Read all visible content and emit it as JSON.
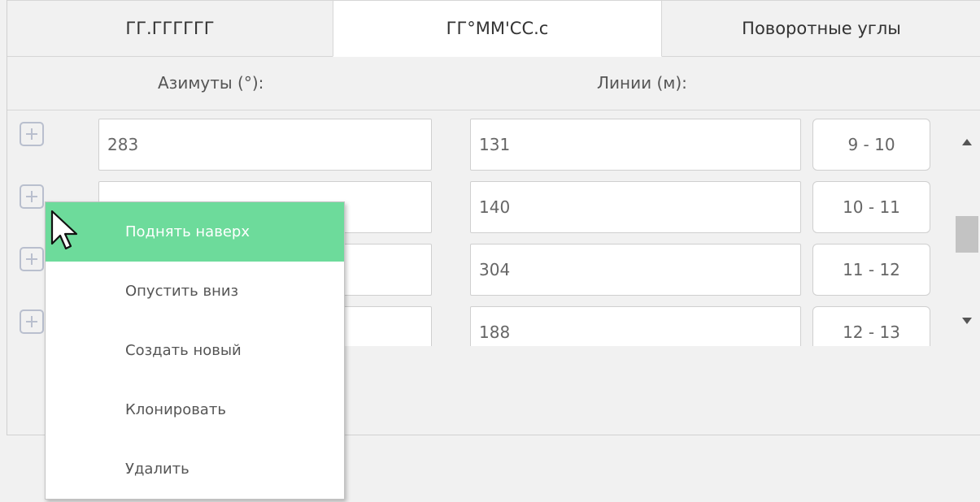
{
  "tabs": [
    {
      "label": "ГГ.ГГГГГГ",
      "active": false
    },
    {
      "label": "ГГ°ММ'СС.с",
      "active": true
    },
    {
      "label": "Поворотные углы",
      "active": false
    }
  ],
  "headers": {
    "azimuths": "Азимуты (°):",
    "lines": "Линии (м):"
  },
  "rows": [
    {
      "azimuth": "283",
      "line": "131",
      "segment": "9 - 10"
    },
    {
      "azimuth": "",
      "line": "140",
      "segment": "10 - 11"
    },
    {
      "azimuth": "",
      "line": "304",
      "segment": "11 - 12"
    },
    {
      "azimuth": "",
      "line": "188",
      "segment": "12 - 13"
    }
  ],
  "context_menu": {
    "items": [
      {
        "label": "Поднять наверх",
        "highlighted": true
      },
      {
        "label": "Опустить вниз",
        "highlighted": false
      },
      {
        "label": "Создать новый",
        "highlighted": false
      },
      {
        "label": "Клонировать",
        "highlighted": false
      },
      {
        "label": "Удалить",
        "highlighted": false
      }
    ],
    "highlight_color": "#6ddb9b"
  },
  "icons": {
    "add": "plus-square-icon",
    "scroll_up": "caret-up-icon",
    "scroll_down": "caret-down-icon",
    "pointer": "mouse-pointer-icon"
  }
}
